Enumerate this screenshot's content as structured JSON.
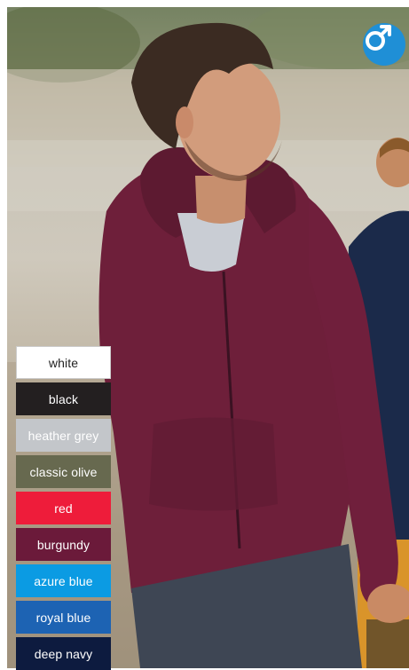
{
  "gender_badge": {
    "icon": "male-symbol-icon",
    "color": "#1f8fd6"
  },
  "colors": [
    {
      "label": "white",
      "bg": "#ffffff",
      "text": "#222222",
      "border": "#cccccc"
    },
    {
      "label": "black",
      "bg": "#231f20",
      "text": "#ffffff"
    },
    {
      "label": "heather grey",
      "bg": "#c3c6ca",
      "text": "#ffffff"
    },
    {
      "label": "classic olive",
      "bg": "#67694f",
      "text": "#ffffff"
    },
    {
      "label": "red",
      "bg": "#ee1c3a",
      "text": "#ffffff"
    },
    {
      "label": "burgundy",
      "bg": "#6b1a3a",
      "text": "#ffffff"
    },
    {
      "label": "azure blue",
      "bg": "#0b9be3",
      "text": "#ffffff"
    },
    {
      "label": "royal blue",
      "bg": "#1d63b3",
      "text": "#ffffff"
    },
    {
      "label": "deep navy",
      "bg": "#0d1b3f",
      "text": "#ffffff"
    }
  ]
}
